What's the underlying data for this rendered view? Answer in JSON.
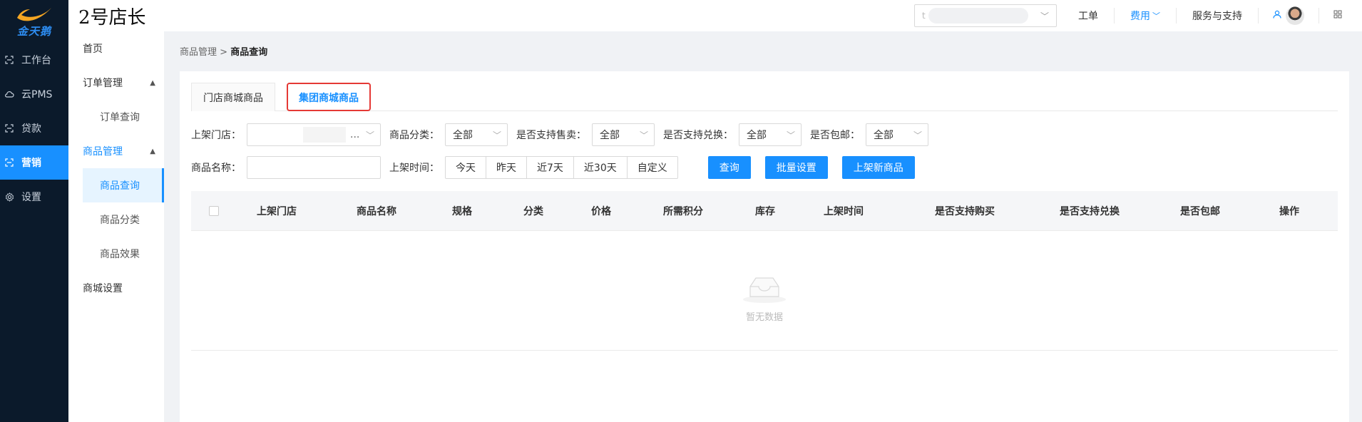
{
  "brand": {
    "name": "金天鹅"
  },
  "header": {
    "title": "2号店长",
    "store_select_prefix": "t",
    "links": {
      "ticket": "工单",
      "fees": "费用",
      "service": "服务与支持"
    }
  },
  "rail": {
    "items": [
      {
        "label": "工作台",
        "icon": "workbench-icon"
      },
      {
        "label": "云PMS",
        "icon": "cloud-icon"
      },
      {
        "label": "贷款",
        "icon": "loan-icon"
      },
      {
        "label": "营销",
        "icon": "marketing-icon"
      },
      {
        "label": "设置",
        "icon": "settings-icon"
      }
    ],
    "active": "营销"
  },
  "sidebar": {
    "home": "首页",
    "order_group": "订单管理",
    "order_query": "订单查询",
    "product_group": "商品管理",
    "product_query": "商品查询",
    "product_category": "商品分类",
    "product_effect": "商品效果",
    "mall_settings": "商城设置"
  },
  "breadcrumb": {
    "parent": "商品管理",
    "separator": " > ",
    "current": "商品查询"
  },
  "tabs": {
    "store_mall": "门店商城商品",
    "group_mall": "集团商城商品"
  },
  "filters": {
    "store_label": "上架门店：",
    "store_value": "...",
    "category_label": "商品分类：",
    "category_value": "全部",
    "sale_label": "是否支持售卖：",
    "sale_value": "全部",
    "exchange_label": "是否支持兑换：",
    "exchange_value": "全部",
    "shipping_label": "是否包邮：",
    "shipping_value": "全部",
    "name_label": "商品名称：",
    "time_label": "上架时间：",
    "time_options": [
      "今天",
      "昨天",
      "近7天",
      "近30天",
      "自定义"
    ]
  },
  "buttons": {
    "query": "查询",
    "batch": "批量设置",
    "new_product": "上架新商品"
  },
  "table": {
    "columns": [
      "上架门店",
      "商品名称",
      "规格",
      "分类",
      "价格",
      "所需积分",
      "库存",
      "上架时间",
      "是否支持购买",
      "是否支持兑换",
      "是否包邮",
      "操作"
    ],
    "empty_text": "暂无数据"
  },
  "colors": {
    "primary": "#1890ff",
    "rail_bg": "#0b1a2b",
    "highlight": "#e53935"
  }
}
